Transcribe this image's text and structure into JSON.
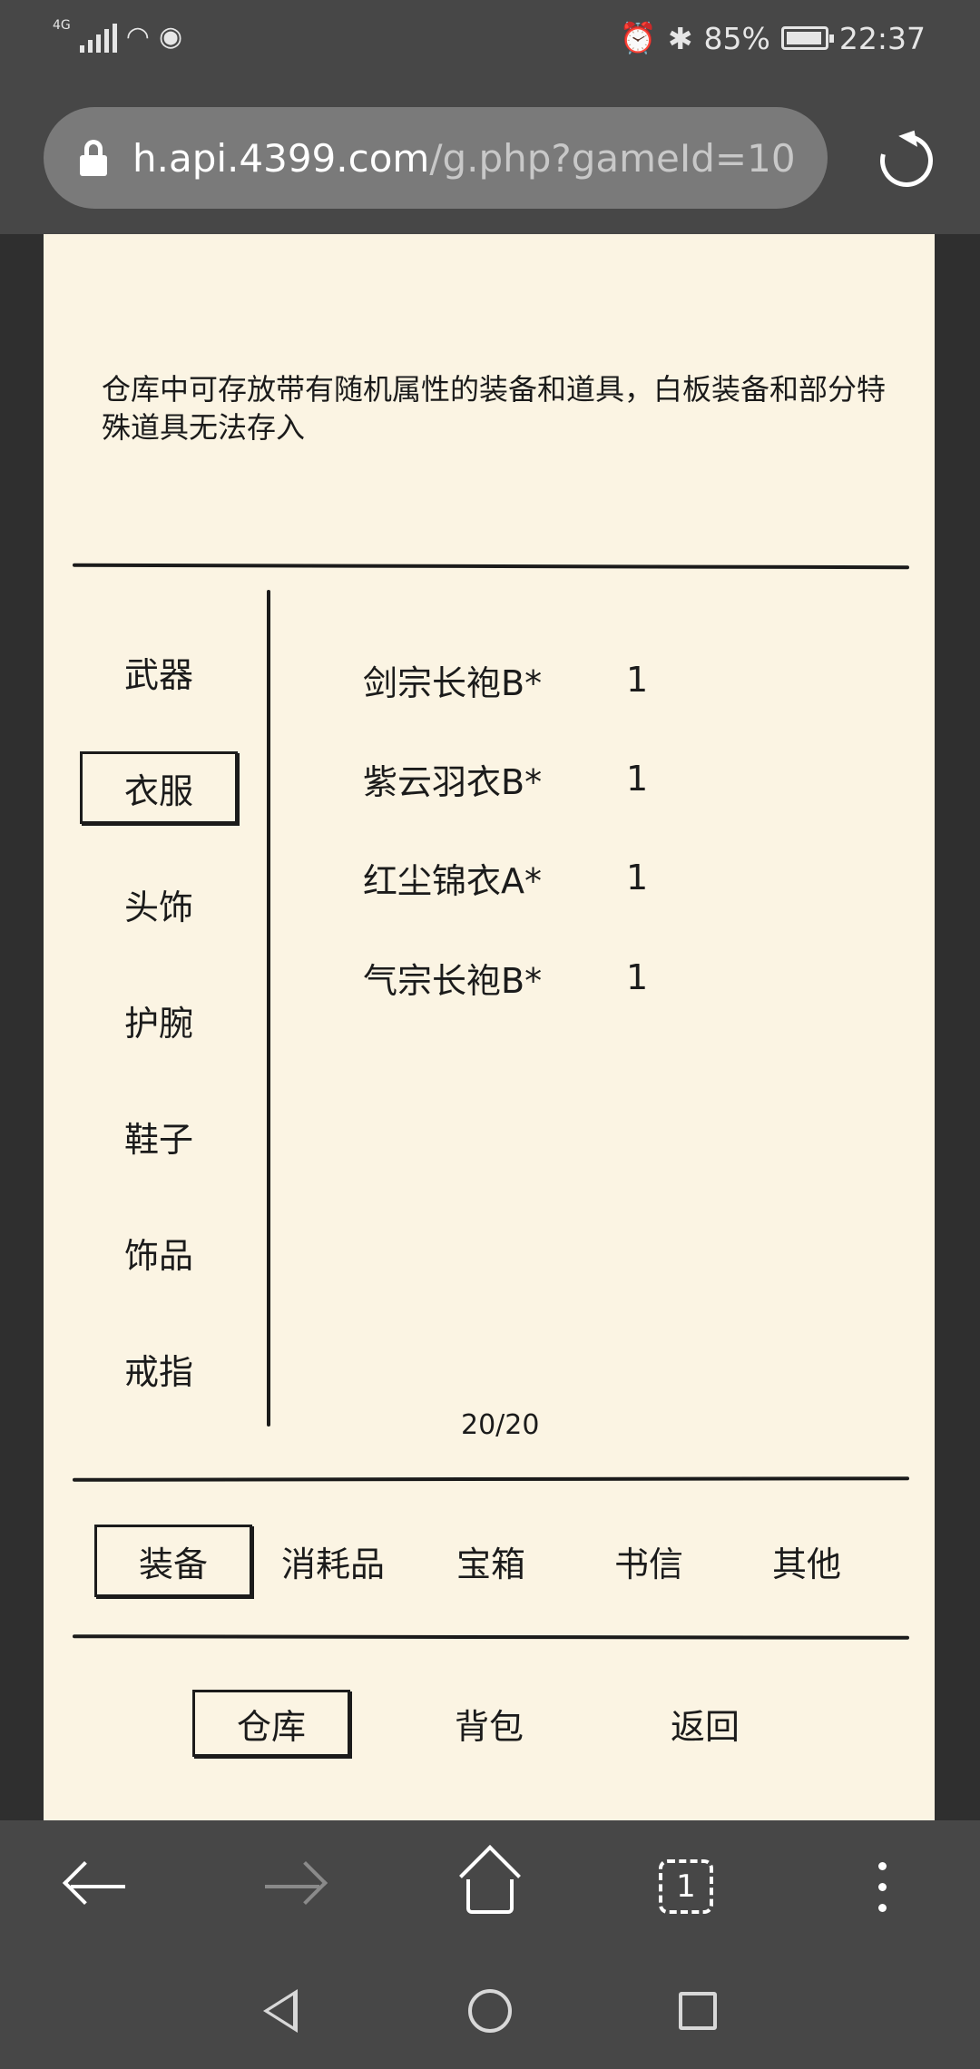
{
  "status_bar": {
    "network": "4G",
    "battery": "85%",
    "time": "22:37"
  },
  "url_bar": {
    "host": "h.api.4399.com",
    "path": "/g.php?gameId=10"
  },
  "notice": "仓库中可存放带有随机属性的装备和道具，白板装备和部分特殊道具无法存入",
  "categories": [
    "武器",
    "衣服",
    "头饰",
    "护腕",
    "鞋子",
    "饰品",
    "戒指"
  ],
  "selected_category": "衣服",
  "items": [
    {
      "name": "剑宗长袍B*",
      "qty": "1"
    },
    {
      "name": "紫云羽衣B*",
      "qty": "1"
    },
    {
      "name": "红尘锦衣A*",
      "qty": "1"
    },
    {
      "name": "气宗长袍B*",
      "qty": "1"
    }
  ],
  "capacity": "20/20",
  "tabs": [
    "装备",
    "消耗品",
    "宝箱",
    "书信",
    "其他"
  ],
  "selected_tab": "装备",
  "bottom_buttons": [
    "仓库",
    "背包",
    "返回"
  ],
  "selected_bottom": "仓库",
  "browser_nav": {
    "tab_count": "1"
  }
}
